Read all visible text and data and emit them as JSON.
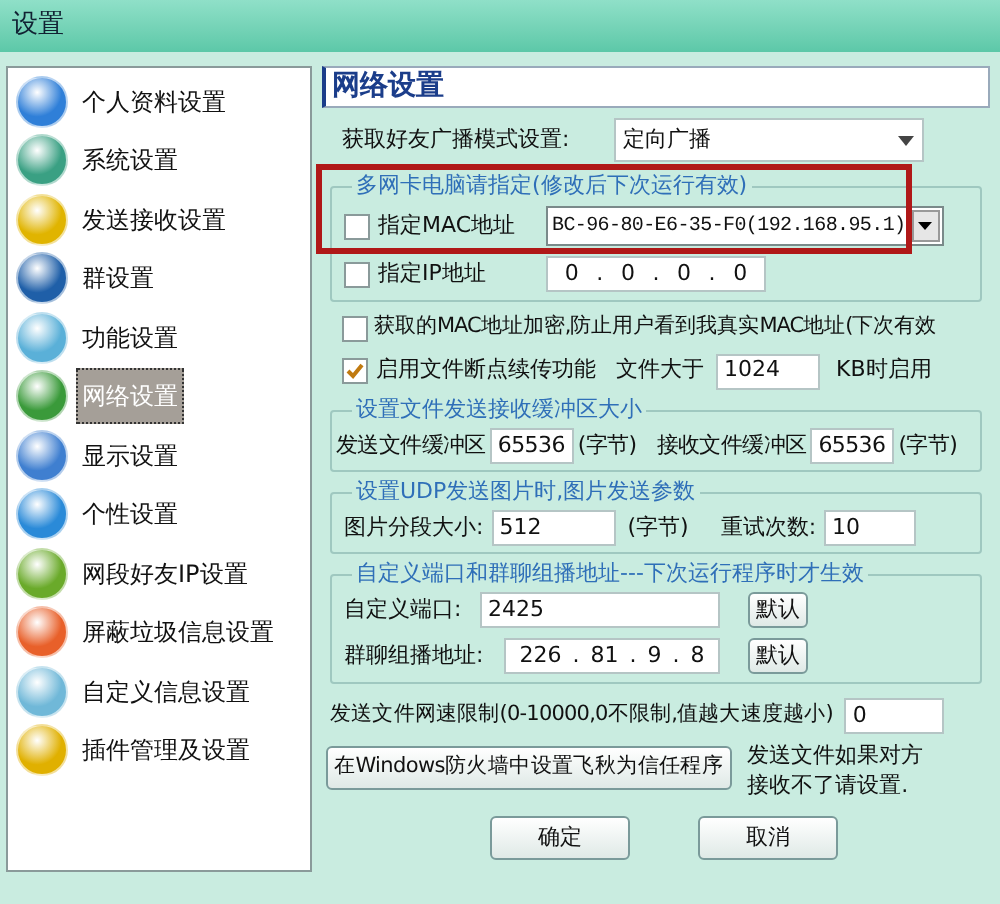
{
  "window": {
    "title": "设置"
  },
  "sidebar": {
    "items": [
      {
        "label": "个人资料设置",
        "selected": false,
        "color": "#2f7fd8"
      },
      {
        "label": "系统设置",
        "selected": false,
        "color": "#3aa083"
      },
      {
        "label": "发送接收设置",
        "selected": false,
        "color": "#e0b400"
      },
      {
        "label": "群设置",
        "selected": false,
        "color": "#1f5fa8"
      },
      {
        "label": "功能设置",
        "selected": false,
        "color": "#5ab0d8"
      },
      {
        "label": "网络设置",
        "selected": true,
        "color": "#3a9a3a"
      },
      {
        "label": "显示设置",
        "selected": false,
        "color": "#3f7fd0"
      },
      {
        "label": "个性设置",
        "selected": false,
        "color": "#2a8ad8"
      },
      {
        "label": "网段好友IP设置",
        "selected": false,
        "color": "#6aaa2a"
      },
      {
        "label": "屏蔽垃圾信息设置",
        "selected": false,
        "color": "#e8602a"
      },
      {
        "label": "自定义信息设置",
        "selected": false,
        "color": "#70b8d8"
      },
      {
        "label": "插件管理及设置",
        "selected": false,
        "color": "#e0b000"
      }
    ]
  },
  "panel": {
    "title": "网络设置",
    "broadcast_mode": {
      "label": "获取好友广播模式设置:",
      "value": "定向广播"
    },
    "multi_nic": {
      "title": "多网卡电脑请指定(修改后下次运行有效)",
      "mac": {
        "label": "指定MAC地址",
        "checked": false,
        "value": "BC-96-80-E6-35-F0(192.168.95.1)"
      },
      "ip": {
        "label": "指定IP地址",
        "checked": false,
        "octets": [
          "0",
          "0",
          "0",
          "0"
        ],
        "separator": "."
      }
    },
    "encrypt_mac": {
      "label": "获取的MAC地址加密,防止用户看到我真实MAC地址(下次有效",
      "checked": false
    },
    "resume": {
      "label": "启用文件断点续传功能",
      "checked": true,
      "size_label": "文件大于",
      "value": "1024",
      "unit": "KB时启用"
    },
    "buffers": {
      "title": "设置文件发送接收缓冲区大小",
      "send_label": "发送文件缓冲区",
      "send_value": "65536",
      "send_unit": "(字节)",
      "recv_label": "接收文件缓冲区",
      "recv_value": "65536",
      "recv_unit": "(字节)"
    },
    "udp": {
      "title": "设置UDP发送图片时,图片发送参数",
      "segment_label": "图片分段大小:",
      "segment_value": "512",
      "segment_unit": "(字节)",
      "retry_label": "重试次数:",
      "retry_value": "10"
    },
    "ports": {
      "title": "自定义端口和群聊组播地址---下次运行程序时才生效",
      "port_label": "自定义端口:",
      "port_value": "2425",
      "port_default": "默认",
      "multicast_label": "群聊组播地址:",
      "multicast_octets": [
        "226",
        "81",
        "9",
        "8"
      ],
      "separator": ".",
      "multicast_default": "默认"
    },
    "speed_limit": {
      "label": "发送文件网速限制(0-10000,0不限制,值越大速度越小)",
      "value": "0"
    },
    "firewall_button": "在Windows防火墙中设置飞秋为信任程序",
    "firewall_note": [
      "发送文件如果对方",
      "接收不了请设置."
    ]
  },
  "buttons": [
    "确定",
    "取消"
  ]
}
